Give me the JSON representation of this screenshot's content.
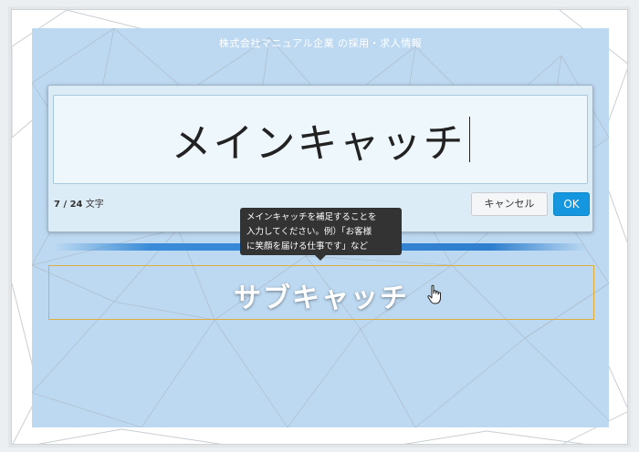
{
  "header": {
    "company_title": "株式会社マニュアル企業 の採用・求人情報"
  },
  "editor": {
    "main_catch_value": "メインキャッチ",
    "char_count_current": "7",
    "char_count_sep": " / ",
    "char_count_max": "24",
    "char_count_unit": "文字",
    "cancel_label": "キャンセル",
    "ok_label": "OK"
  },
  "tooltip": {
    "line1": "メインキャッチを補足することを",
    "line2": "入力してください。例）「お客様",
    "line3": "に笑顔を届ける仕事です」など"
  },
  "sub_catch": {
    "text": "サブキャッチ"
  },
  "icons": {
    "cursor": "hand-pointer-icon"
  },
  "colors": {
    "hero_bg": "#bdd9f1",
    "ok_button": "#1497df",
    "sub_box_border": "#e1ad3a",
    "accent_bar": "#2f7fcf"
  }
}
